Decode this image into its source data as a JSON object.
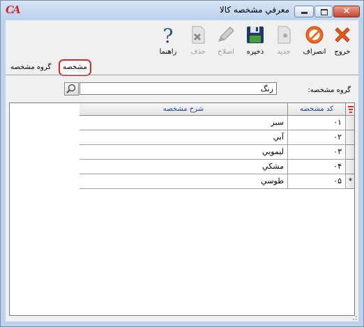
{
  "window": {
    "title": "معرفي مشخصه کالا",
    "logo_text": "CA",
    "controls": {
      "minimize": "minimize",
      "maximize": "maximize",
      "close": "✕"
    }
  },
  "toolbar": {
    "items": [
      {
        "label": "خروج",
        "icon": "exit-x-icon",
        "enabled": true
      },
      {
        "label": "انصراف",
        "icon": "cancel-icon",
        "enabled": true
      },
      {
        "label": "ذخيره",
        "icon": "save-disk-icon",
        "enabled": true
      },
      {
        "label": "جديد",
        "icon": "new-document-icon",
        "enabled": false
      },
      {
        "label": "اصلاح",
        "icon": "edit-pencil-icon",
        "enabled": false
      },
      {
        "label": "حذف",
        "icon": "delete-document-icon",
        "enabled": false
      },
      {
        "label": "راهنما",
        "icon": "help-icon",
        "enabled": true
      }
    ]
  },
  "tabs": {
    "active": "مشخصه",
    "inactive": "گروه مشخصه"
  },
  "group": {
    "label": "گروه مشخصه:",
    "value": "رنگ"
  },
  "grid": {
    "columns": {
      "code": "کد مشخصه",
      "description": "شرح مشخصه"
    },
    "rows": [
      {
        "code": "۰۱",
        "description": "سبز",
        "marker": ""
      },
      {
        "code": "۰۲",
        "description": "آبي",
        "marker": ""
      },
      {
        "code": "۰۳",
        "description": "ليمويي",
        "marker": ""
      },
      {
        "code": "۰۴",
        "description": "مشکي",
        "marker": ""
      },
      {
        "code": "۰۵",
        "description": "طوسي",
        "marker": "*"
      }
    ]
  },
  "colors": {
    "title_bar": "#bcd3ee",
    "accent_red": "#d9262c",
    "header_text": "#1a3f9a"
  }
}
